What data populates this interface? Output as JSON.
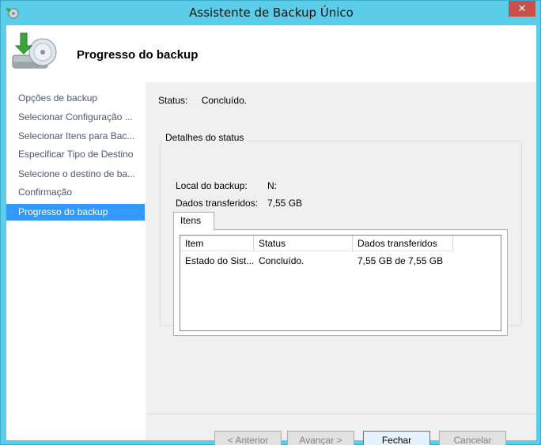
{
  "window": {
    "title": "Assistente de Backup Único",
    "close_label": "✕"
  },
  "header": {
    "title": "Progresso do backup"
  },
  "sidebar": {
    "items": [
      {
        "label": "Opções de backup"
      },
      {
        "label": "Selecionar Configuração ..."
      },
      {
        "label": "Selecionar Itens para Bac..."
      },
      {
        "label": "Especificar Tipo de Destino"
      },
      {
        "label": "Selecione o destino de ba..."
      },
      {
        "label": "Confirmação"
      },
      {
        "label": "Progresso do backup"
      }
    ],
    "active_index": 6
  },
  "status": {
    "label": "Status:",
    "value": "Concluído."
  },
  "details": {
    "legend": "Detalhes do status",
    "location_label": "Local do backup:",
    "location_value": "N:",
    "transferred_label": "Dados transferidos:",
    "transferred_value": "7,55 GB"
  },
  "items_tab": {
    "label": "Itens",
    "columns": [
      "Item",
      "Status",
      "Dados transferidos"
    ],
    "rows": [
      {
        "item": "Estado do Sist...",
        "status": "Concluído.",
        "transferred": "7,55 GB de 7,55 GB"
      }
    ]
  },
  "buttons": {
    "back": "< Anterior",
    "next": "Avançar >",
    "close": "Fechar",
    "cancel": "Cancelar"
  },
  "colors": {
    "frame": "#5ccde8",
    "selection": "#3399ff",
    "close_button": "#c7504a"
  }
}
